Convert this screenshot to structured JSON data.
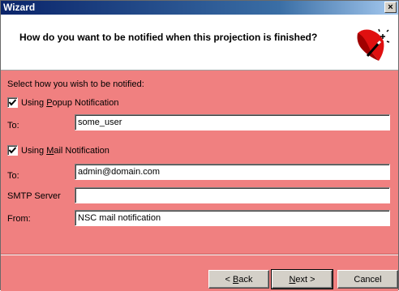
{
  "window": {
    "title": "Wizard",
    "close_glyph": "×"
  },
  "header": {
    "question": "How do you want to be notified when this projection is finished?",
    "icon": "magic-wand-icon"
  },
  "main": {
    "instruction": "Select how you wish to be notified:",
    "popup": {
      "checked": true,
      "label_pre": "Using ",
      "label_accel": "P",
      "label_post": "opup Notification",
      "to_label": "To:",
      "to_value": "some_user"
    },
    "mail": {
      "checked": true,
      "label_pre": "Using ",
      "label_accel": "M",
      "label_post": "ail Notification",
      "to_label": "To:",
      "to_value": "admin@domain.com",
      "smtp_label": "SMTP Server",
      "smtp_value": "",
      "from_label": "From:",
      "from_value": "NSC mail notification"
    }
  },
  "footer": {
    "back_pre": "< ",
    "back_accel": "B",
    "back_post": "ack",
    "next_accel": "N",
    "next_post": "ext >",
    "cancel_label": "Cancel"
  },
  "colors": {
    "panel": "#f08080",
    "title_gradient_start": "#0a246a",
    "title_gradient_end": "#a6caf0"
  }
}
